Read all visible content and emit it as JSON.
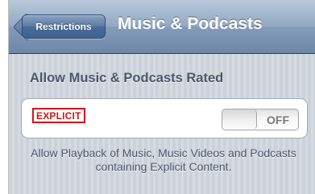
{
  "navbar": {
    "back_label": "Restrictions",
    "title": "Music & Podcasts"
  },
  "section": {
    "header": "Allow Music & Podcasts Rated"
  },
  "explicit_row": {
    "badge": "EXPLICIT",
    "toggle_state": "OFF"
  },
  "footer_text": "Allow Playback of Music, Music Videos and Podcasts containing Explicit Content.",
  "colors": {
    "nav_bar": "#839bb9",
    "badge_red": "#d4141a",
    "background": "#cbd2d9"
  }
}
